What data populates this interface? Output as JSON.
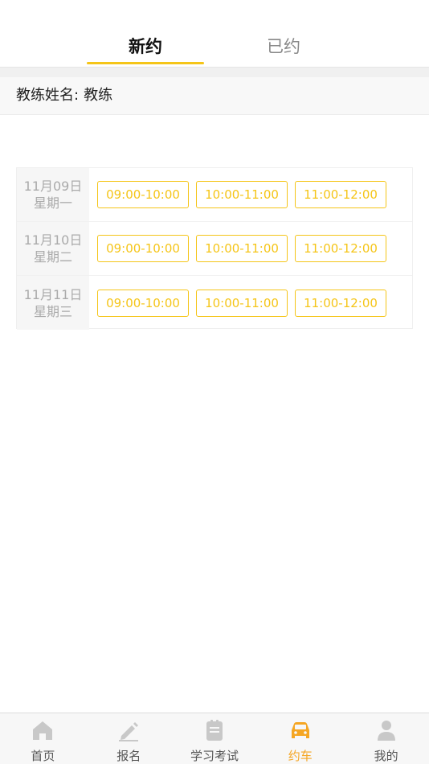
{
  "tabs": {
    "new_label": "新约",
    "booked_label": "已约"
  },
  "coach": {
    "label": "教练姓名:",
    "name": "教练"
  },
  "schedule": [
    {
      "date": "11月09日",
      "weekday": "星期一",
      "slots": [
        "09:00-10:00",
        "10:00-11:00",
        "11:00-12:00"
      ]
    },
    {
      "date": "11月10日",
      "weekday": "星期二",
      "slots": [
        "09:00-10:00",
        "10:00-11:00",
        "11:00-12:00"
      ]
    },
    {
      "date": "11月11日",
      "weekday": "星期三",
      "slots": [
        "09:00-10:00",
        "10:00-11:00",
        "11:00-12:00"
      ]
    }
  ],
  "nav": {
    "items": [
      {
        "label": "首页",
        "icon": "home-icon"
      },
      {
        "label": "报名",
        "icon": "pencil-icon"
      },
      {
        "label": "学习考试",
        "icon": "notebook-icon"
      },
      {
        "label": "约车",
        "icon": "car-icon"
      },
      {
        "label": "我的",
        "icon": "person-icon"
      }
    ]
  },
  "colors": {
    "accent": "#f5c518",
    "nav_active": "#f5a623",
    "nav_inactive_icon": "#c8c8c8"
  }
}
